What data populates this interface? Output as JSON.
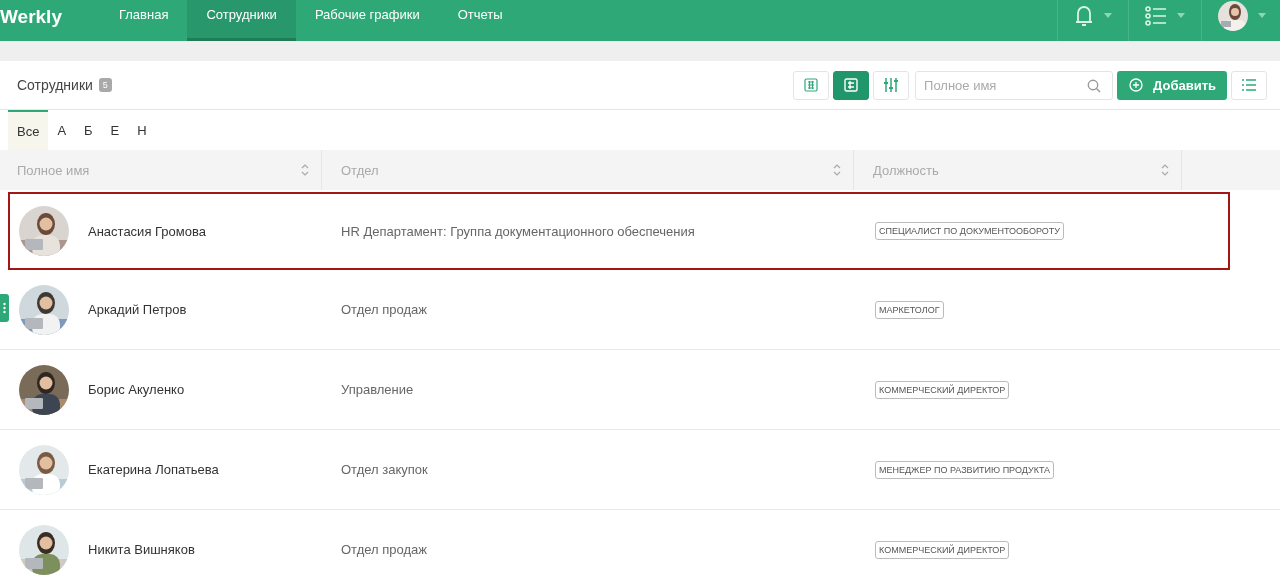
{
  "logo": "Werkly",
  "nav": [
    {
      "label": "Главная",
      "selected": false
    },
    {
      "label": "Сотрудники",
      "selected": true
    },
    {
      "label": "Рабочие графики",
      "selected": false
    },
    {
      "label": "Отчеты",
      "selected": false
    }
  ],
  "panel": {
    "title": "Сотрудники",
    "count": "5"
  },
  "view_buttons": [
    {
      "kind": "grid",
      "selected": false
    },
    {
      "kind": "cards",
      "selected": true
    },
    {
      "kind": "filters",
      "selected": false
    }
  ],
  "search": {
    "placeholder": "Полное имя"
  },
  "add_button": "Добавить",
  "letters": [
    {
      "label": "Все",
      "selected": true
    },
    {
      "label": "А",
      "selected": false
    },
    {
      "label": "Б",
      "selected": false
    },
    {
      "label": "Е",
      "selected": false
    },
    {
      "label": "Н",
      "selected": false
    }
  ],
  "columns": [
    "Полное имя",
    "Отдел",
    "Должность"
  ],
  "rows": [
    {
      "name": "Анастасия Громова",
      "department": "HR Департамент: Группа документационного обеспечения",
      "position": "СПЕЦИАЛИСТ ПО ДОКУМЕНТООБОРОТУ",
      "selected": true
    },
    {
      "name": "Аркадий Петров",
      "department": "Отдел продаж",
      "position": "МАРКЕТОЛОГ",
      "selected": false
    },
    {
      "name": "Борис Акуленко",
      "department": "Управление",
      "position": "КОММЕРЧЕСКИЙ ДИРЕКТОР",
      "selected": false
    },
    {
      "name": "Екатерина Лопатьева",
      "department": "Отдел закупок",
      "position": "МЕНЕДЖЕР ПО РАЗВИТИЮ ПРОДУКТА",
      "selected": false
    },
    {
      "name": "Никита Вишняков",
      "department": "Отдел продаж",
      "position": "КОММЕРЧЕСКИЙ ДИРЕКТОР",
      "selected": false
    }
  ]
}
